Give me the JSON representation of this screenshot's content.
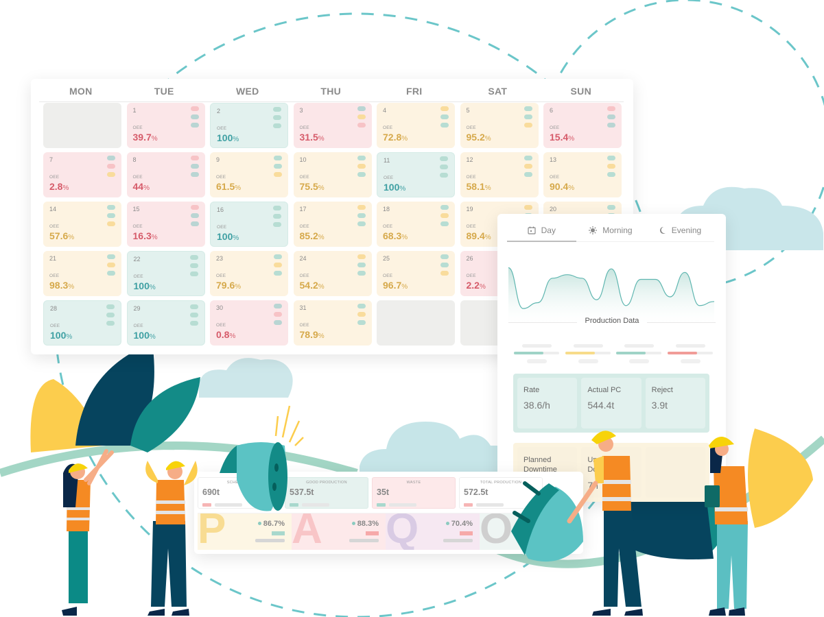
{
  "calendar": {
    "weekdays": [
      "MON",
      "TUE",
      "WED",
      "THU",
      "FRI",
      "SAT",
      "SUN"
    ],
    "oee_label": "OEE",
    "percent_sign": "%",
    "days": [
      {
        "day": "",
        "status": "empty"
      },
      {
        "day": "1",
        "oee": "39.7",
        "status": "red",
        "shifts": [
          "r",
          "g",
          "g"
        ]
      },
      {
        "day": "2",
        "oee": "100",
        "status": "teal",
        "shifts": [
          "t",
          "t",
          "t"
        ]
      },
      {
        "day": "3",
        "oee": "31.5",
        "status": "red",
        "shifts": [
          "g",
          "y",
          "r"
        ]
      },
      {
        "day": "4",
        "oee": "72.8",
        "status": "yellow",
        "shifts": [
          "y",
          "t",
          "t"
        ]
      },
      {
        "day": "5",
        "oee": "95.2",
        "status": "yellow",
        "shifts": [
          "t",
          "t",
          "y"
        ]
      },
      {
        "day": "6",
        "oee": "15.4",
        "status": "red",
        "shifts": [
          "r",
          "g",
          "g"
        ]
      },
      {
        "day": "7",
        "oee": "2.8",
        "status": "red",
        "shifts": [
          "g",
          "r",
          "y"
        ]
      },
      {
        "day": "8",
        "oee": "44",
        "status": "red",
        "shifts": [
          "r",
          "g",
          "g"
        ]
      },
      {
        "day": "9",
        "oee": "61.5",
        "status": "yellow",
        "shifts": [
          "t",
          "t",
          "y"
        ]
      },
      {
        "day": "10",
        "oee": "75.5",
        "status": "yellow",
        "shifts": [
          "t",
          "y",
          "t"
        ]
      },
      {
        "day": "11",
        "oee": "100",
        "status": "teal",
        "shifts": [
          "t",
          "t",
          "t"
        ]
      },
      {
        "day": "12",
        "oee": "58.1",
        "status": "yellow",
        "shifts": [
          "t",
          "y",
          "t"
        ]
      },
      {
        "day": "13",
        "oee": "90.4",
        "status": "yellow",
        "shifts": [
          "t",
          "y",
          "t"
        ]
      },
      {
        "day": "14",
        "oee": "57.6",
        "status": "yellow",
        "shifts": [
          "t",
          "t",
          "y"
        ]
      },
      {
        "day": "15",
        "oee": "16.3",
        "status": "red",
        "shifts": [
          "r",
          "g",
          "g"
        ]
      },
      {
        "day": "16",
        "oee": "100",
        "status": "teal",
        "shifts": [
          "t",
          "t",
          "t"
        ]
      },
      {
        "day": "17",
        "oee": "85.2",
        "status": "yellow",
        "shifts": [
          "y",
          "t",
          "t"
        ]
      },
      {
        "day": "18",
        "oee": "68.3",
        "status": "yellow",
        "shifts": [
          "t",
          "y",
          "t"
        ]
      },
      {
        "day": "19",
        "oee": "89.4",
        "status": "yellow",
        "shifts": [
          "y",
          "t",
          "t"
        ]
      },
      {
        "day": "20",
        "oee": "",
        "status": "yellow",
        "shifts": [
          "t",
          "t",
          "t"
        ]
      },
      {
        "day": "21",
        "oee": "98.3",
        "status": "yellow",
        "shifts": [
          "t",
          "y",
          "t"
        ]
      },
      {
        "day": "22",
        "oee": "100",
        "status": "teal",
        "shifts": [
          "t",
          "t",
          "t"
        ]
      },
      {
        "day": "23",
        "oee": "79.6",
        "status": "yellow",
        "shifts": [
          "t",
          "y",
          "t"
        ]
      },
      {
        "day": "24",
        "oee": "54.2",
        "status": "yellow",
        "shifts": [
          "y",
          "t",
          "t"
        ]
      },
      {
        "day": "25",
        "oee": "96.7",
        "status": "yellow",
        "shifts": [
          "t",
          "t",
          "y"
        ]
      },
      {
        "day": "26",
        "oee": "2.2",
        "status": "red",
        "shifts": [
          "r",
          "g",
          "g"
        ]
      },
      {
        "day": "",
        "status": "hidden"
      },
      {
        "day": "28",
        "oee": "100",
        "status": "teal",
        "shifts": [
          "t",
          "t",
          "t"
        ]
      },
      {
        "day": "29",
        "oee": "100",
        "status": "teal",
        "shifts": [
          "t",
          "t",
          "t"
        ]
      },
      {
        "day": "30",
        "oee": "0.8",
        "status": "red",
        "shifts": [
          "g",
          "r",
          "g"
        ]
      },
      {
        "day": "31",
        "oee": "78.9",
        "status": "yellow",
        "shifts": [
          "t",
          "y",
          "t"
        ]
      },
      {
        "day": "",
        "status": "empty"
      },
      {
        "day": "",
        "status": "empty"
      },
      {
        "day": "",
        "status": "hidden"
      }
    ]
  },
  "production_panel": {
    "tabs": [
      {
        "label": "Day",
        "icon": "calendar-icon",
        "active": true
      },
      {
        "label": "Morning",
        "icon": "sun-icon",
        "active": false
      },
      {
        "label": "Evening",
        "icon": "moon-icon",
        "active": false
      }
    ],
    "section_title": "Production Data",
    "progress": [
      {
        "fill": 0.65,
        "color": "#9fd3c7"
      },
      {
        "fill": 0.65,
        "color": "#f7dc8a"
      },
      {
        "fill": 0.65,
        "color": "#9fd3c7"
      },
      {
        "fill": 0.65,
        "color": "#f19c98"
      }
    ],
    "stats": [
      {
        "label": "Rate",
        "value": "38.6/h"
      },
      {
        "label": "Actual PC",
        "value": "544.4t"
      },
      {
        "label": "Reject",
        "value": "3.9t"
      }
    ],
    "downtime": [
      {
        "label": "Planned Downtime",
        "value": ""
      },
      {
        "label": "Unplanned Downtime",
        "value": "7h"
      }
    ]
  },
  "paqo_panel": {
    "cards": [
      {
        "title": "SCHEDULED",
        "value": "690t",
        "swatch": "#f6b5b5",
        "style": "plain"
      },
      {
        "title": "GOOD PRODUCTION",
        "value": "537.5t",
        "swatch": "#a8d8cd",
        "style": "good"
      },
      {
        "title": "WASTE",
        "value": "35t",
        "swatch": "#a8d8cd",
        "style": "waste"
      },
      {
        "title": "TOTAL PRODUCTION",
        "value": "572.5t",
        "swatch": "#f6b5b5",
        "style": "plain"
      }
    ],
    "metrics": [
      {
        "letter": "P",
        "value": "86.7%",
        "bg": "#fdf6e4",
        "color": "#f8dc92",
        "swatch": "#a8d8cd"
      },
      {
        "letter": "A",
        "value": "88.3%",
        "bg": "#fde9ea",
        "color": "#f8c5c7",
        "swatch": "#f6a9a9"
      },
      {
        "letter": "Q",
        "value": "70.4%",
        "bg": "#f6e8f2",
        "color": "#d9cbe4",
        "swatch": "#f6a9a9"
      },
      {
        "letter": "O",
        "value": "",
        "bg": "#eef5f3",
        "color": "#cfcfcf",
        "swatch": "#a8d8cd"
      }
    ]
  },
  "chart_wave": {
    "type": "area",
    "values": [
      0.9,
      0.2,
      0.3,
      0.72,
      0.78,
      0.72,
      0.35,
      0.88,
      0.25,
      0.7,
      0.7,
      0.4,
      0.82,
      0.25,
      0.32
    ]
  },
  "colors": {
    "accent_teal": "#5bc0c3",
    "dark_teal": "#0f8a87",
    "navy": "#06445e",
    "yellow": "#fccd4d",
    "orange": "#f58a23"
  }
}
